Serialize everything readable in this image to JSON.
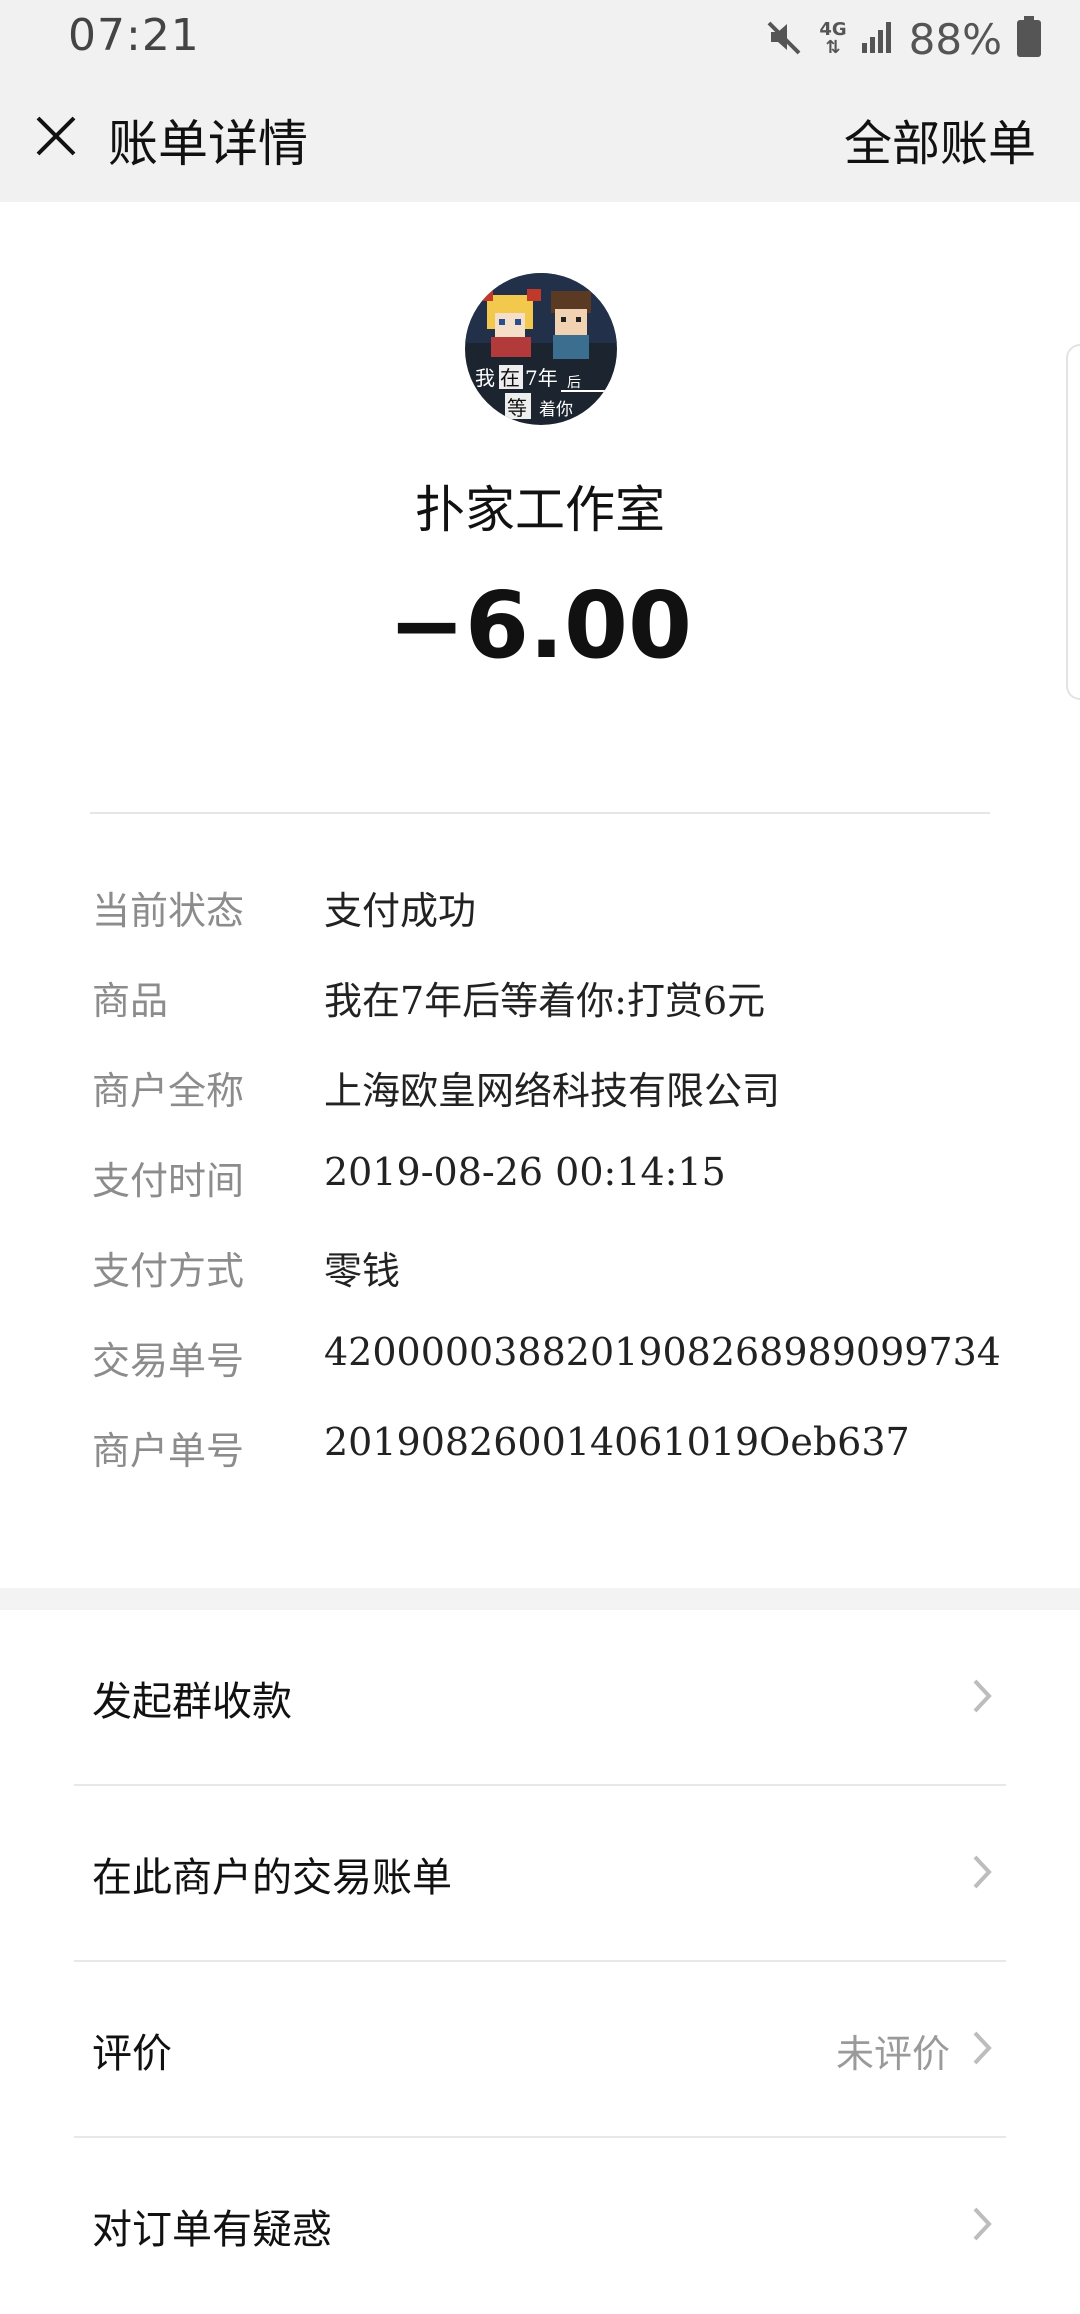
{
  "status_bar": {
    "time": "07:21",
    "network": "4G",
    "battery": "88%"
  },
  "header": {
    "title": "账单详情",
    "right_action": "全部账单"
  },
  "merchant": {
    "avatar_text": [
      "我",
      "在",
      "7年",
      "后",
      "等",
      "着你"
    ],
    "name": "扑家工作室",
    "amount": "−6.00"
  },
  "details": [
    {
      "label": "当前状态",
      "value": "支付成功"
    },
    {
      "label": "商品",
      "value": "我在7年后等着你:打赏6元"
    },
    {
      "label": "商户全称",
      "value": "上海欧皇网络科技有限公司"
    },
    {
      "label": "支付时间",
      "value": "2019-08-26 00:14:15"
    },
    {
      "label": "支付方式",
      "value": "零钱"
    },
    {
      "label": "交易单号",
      "value": "4200000388201908268989099734"
    },
    {
      "label": "商户单号",
      "value": "201908260014061019Oeb637"
    }
  ],
  "menu": [
    {
      "label": "发起群收款",
      "status": ""
    },
    {
      "label": "在此商户的交易账单",
      "status": ""
    },
    {
      "label": "评价",
      "status": "未评价"
    },
    {
      "label": "对订单有疑惑",
      "status": ""
    }
  ],
  "icons": {
    "close": "close-icon",
    "chevron": "chevron-right-icon",
    "mute": "mute-icon",
    "signal": "signal-icon",
    "battery": "battery-icon"
  }
}
